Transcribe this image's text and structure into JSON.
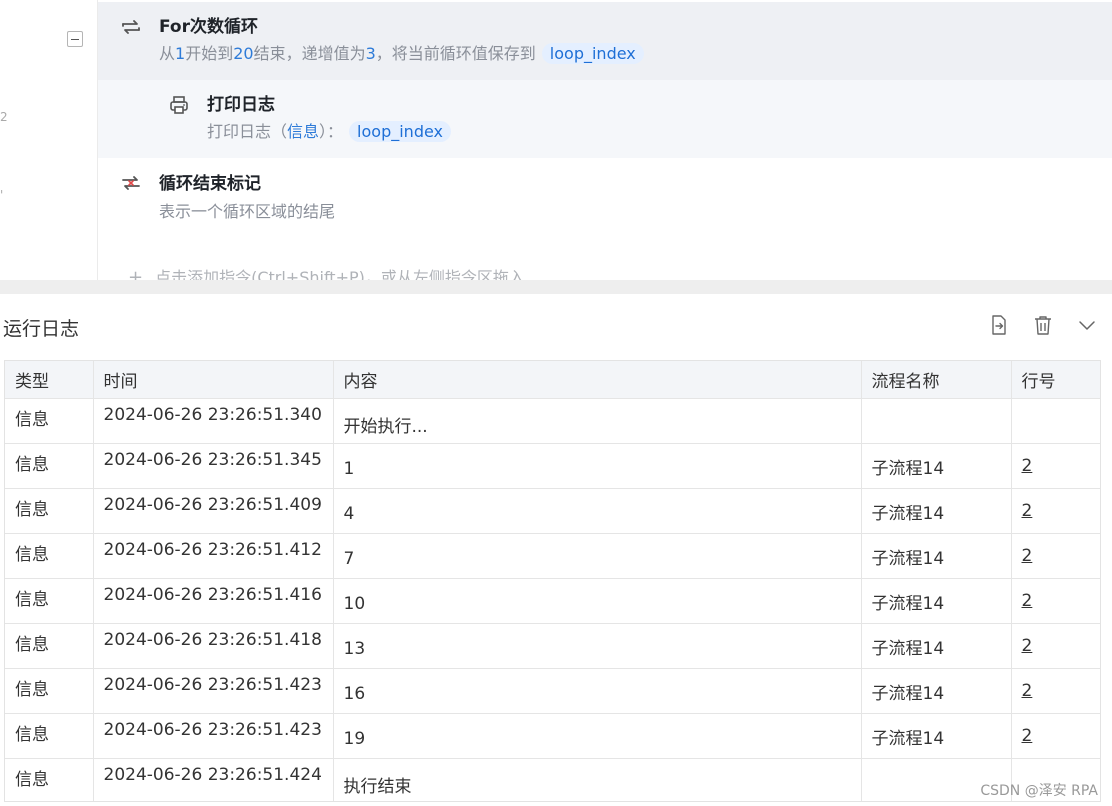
{
  "editor": {
    "for_step": {
      "title": "For次数循环",
      "desc_parts": [
        "从",
        "1",
        "开始到",
        "20",
        "结束，递增值为",
        "3",
        "，将当前循环值保存到"
      ],
      "variable": "loop_index"
    },
    "print_step": {
      "title": "打印日志",
      "desc_prefix": "打印日志（",
      "desc_param": "信息",
      "desc_suffix": "）：",
      "variable": "loop_index"
    },
    "end_step": {
      "title": "循环结束标记",
      "desc": "表示一个循环区域的结尾"
    },
    "add_hint": "点击添加指令(Ctrl+Shift+P)，或从左侧指令区拖入",
    "gutter_marks": [
      "2",
      "'"
    ]
  },
  "log": {
    "title": "运行日志",
    "columns": [
      "类型",
      "时间",
      "内容",
      "流程名称",
      "行号"
    ],
    "rows": [
      {
        "type": "信息",
        "time": "2024-06-26 23:26:51.340",
        "content": "开始执行...",
        "flow": "",
        "line": ""
      },
      {
        "type": "信息",
        "time": "2024-06-26 23:26:51.345",
        "content": "1",
        "flow": "子流程14",
        "line": "2"
      },
      {
        "type": "信息",
        "time": "2024-06-26 23:26:51.409",
        "content": "4",
        "flow": "子流程14",
        "line": "2"
      },
      {
        "type": "信息",
        "time": "2024-06-26 23:26:51.412",
        "content": "7",
        "flow": "子流程14",
        "line": "2"
      },
      {
        "type": "信息",
        "time": "2024-06-26 23:26:51.416",
        "content": "10",
        "flow": "子流程14",
        "line": "2"
      },
      {
        "type": "信息",
        "time": "2024-06-26 23:26:51.418",
        "content": "13",
        "flow": "子流程14",
        "line": "2"
      },
      {
        "type": "信息",
        "time": "2024-06-26 23:26:51.423",
        "content": "16",
        "flow": "子流程14",
        "line": "2"
      },
      {
        "type": "信息",
        "time": "2024-06-26 23:26:51.423",
        "content": "19",
        "flow": "子流程14",
        "line": "2"
      },
      {
        "type": "信息",
        "time": "2024-06-26 23:26:51.424",
        "content": "执行结束",
        "flow": "",
        "line": ""
      }
    ],
    "actions": [
      "export-icon",
      "trash-icon",
      "chevron-down-icon"
    ]
  },
  "watermark": "CSDN @泽安 RPA",
  "colors": {
    "accent": "#1e6fd6",
    "chip_bg": "#e4efff",
    "selected_step_bg": "#eef0f4"
  }
}
